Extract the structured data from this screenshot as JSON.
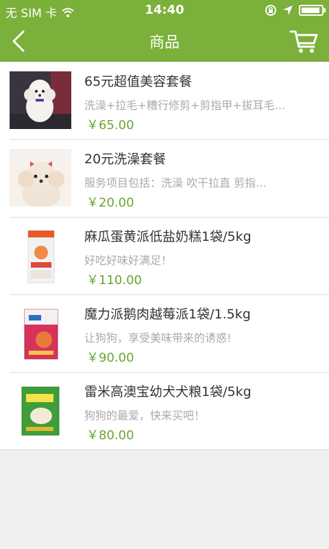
{
  "status_bar": {
    "carrier": "无 SIM 卡",
    "time": "14:40"
  },
  "nav": {
    "title": "商品"
  },
  "colors": {
    "brand_green": "#7bb03a",
    "price_green": "#6aa631"
  },
  "products": [
    {
      "name": "65元超值美容套餐",
      "desc": "洗澡+拉毛+糟行修剪+剪指甲+拔耳毛…",
      "price": "￥65.00",
      "image": "white-poodle-photo"
    },
    {
      "name": "20元洗澡套餐",
      "desc": "服务项目包括：洗澡 吹干拉直 剪指…",
      "price": "￥20.00",
      "image": "poodle-with-bows-photo"
    },
    {
      "name": "麻瓜蛋黄派低盐奶糕1袋/5kg",
      "desc": "好吃好味好满足！",
      "price": "￥110.00",
      "image": "dog-food-bag-white"
    },
    {
      "name": "魔力派鹅肉越莓派1袋/1.5kg",
      "desc": "让狗狗，享受美味带来的诱惑!",
      "price": "￥90.00",
      "image": "dog-food-bag-red"
    },
    {
      "name": "雷米高澳宝幼犬犬粮1袋/5kg",
      "desc": "狗狗的最爱，快来买吧！",
      "price": "￥80.00",
      "image": "dog-food-bag-green"
    }
  ]
}
